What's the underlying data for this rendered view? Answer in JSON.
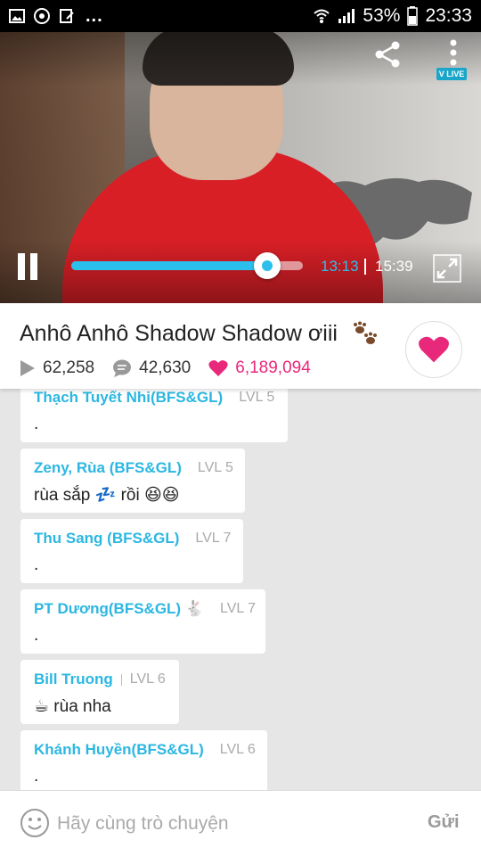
{
  "status_bar": {
    "battery": "53%",
    "time": "23:33",
    "more": "..."
  },
  "video": {
    "current_time": "13:13",
    "total_time": "15:39",
    "progress_fraction": 0.845,
    "logo_text": "V LIVE"
  },
  "info": {
    "title": "Anhô Anhô Shadow Shadow ơiii",
    "views": "62,258",
    "comments": "42,630",
    "likes": "6,189,094",
    "accent_color": "#e8287a"
  },
  "chat": {
    "messages": [
      {
        "name": "Thạch Tuyết Nhi(BFS&GL)",
        "level": "LVL 5",
        "text": "."
      },
      {
        "name": "Zeny, Rùa (BFS&GL)",
        "level": "LVL 5",
        "text": "rùa sắp 💤 rồi 😆😆"
      },
      {
        "name": "Thu Sang (BFS&GL)",
        "level": "LVL 7",
        "text": "."
      },
      {
        "name": "PT Dương(BFS&GL) 🐇",
        "level": "LVL 7",
        "text": "."
      },
      {
        "name": "Bill Truong",
        "level": "LVL 6",
        "text": "☕ rùa nha"
      },
      {
        "name": "Khánh Huyền(BFS&GL)",
        "level": "LVL 6",
        "text": "."
      }
    ]
  },
  "input": {
    "placeholder": "Hãy cùng trò chuyện",
    "send_label": "Gửi"
  }
}
